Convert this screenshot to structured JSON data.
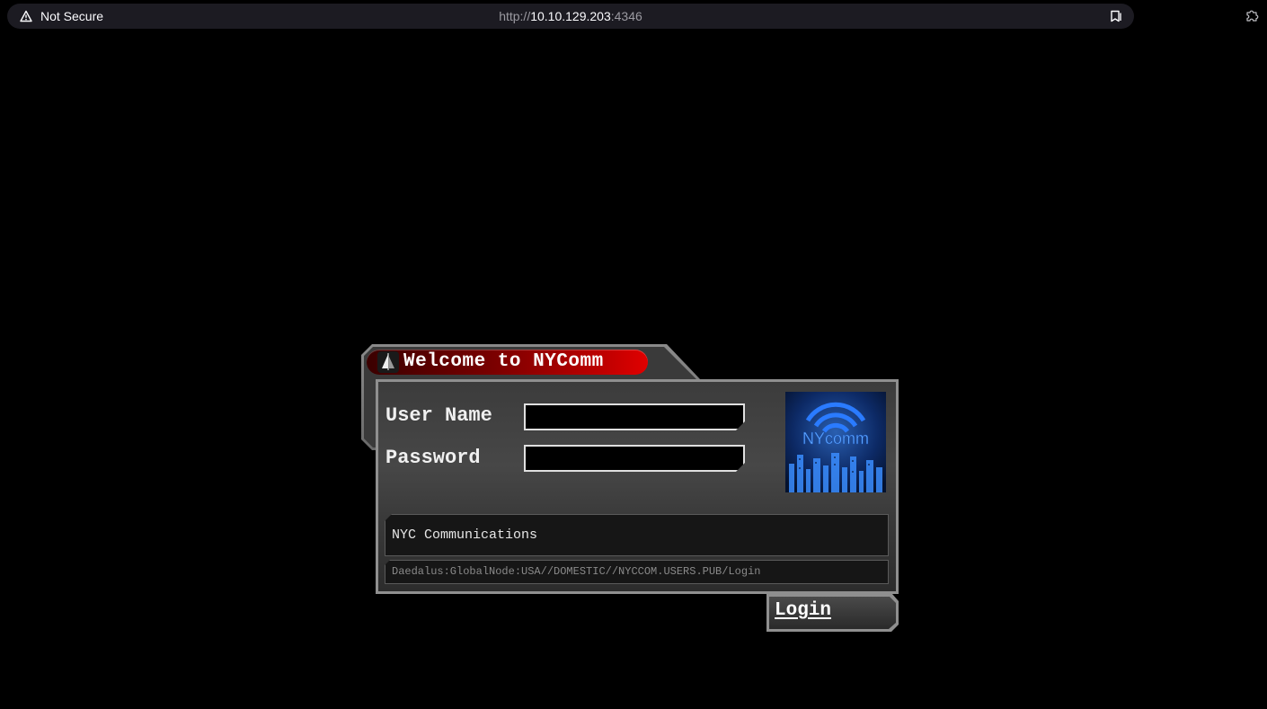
{
  "browser": {
    "security_label": "Not Secure",
    "url_scheme": "http://",
    "url_host": "10.10.129.203",
    "url_port": ":4346"
  },
  "dialog": {
    "title": "Welcome to NYComm",
    "username_label": "User Name",
    "username_value": "",
    "password_label": "Password",
    "password_value": "",
    "logo_text": "NYcomm",
    "info_text": "NYC Communications",
    "node_path": "Daedalus:GlobalNode:USA//DOMESTIC//NYCCOM.USERS.PUB/Login",
    "login_label": "Login"
  },
  "colors": {
    "title_pill": "#c00000",
    "logo_blue": "#2a7bff",
    "background": "#000000"
  },
  "icons": {
    "security": "warning-triangle-icon",
    "reader": "reader-mode-icon",
    "extensions": "puzzle-icon",
    "title": "sailboat-icon"
  }
}
